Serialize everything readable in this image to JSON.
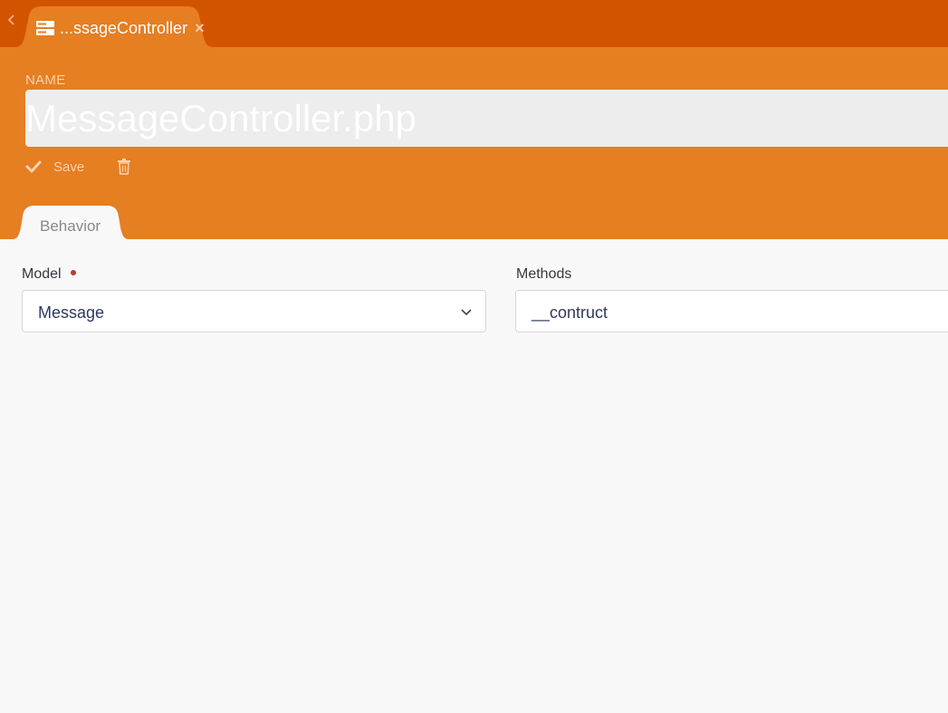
{
  "tabbar": {
    "tab_title": "...ssageController",
    "icons": {
      "back": "chevron-left-icon",
      "file": "server-icon",
      "close": "close-icon"
    }
  },
  "header": {
    "name_label": "NAME",
    "name_value": "MessageController.php",
    "save_label": "Save",
    "icons": {
      "save": "check-icon",
      "delete": "trash-icon"
    }
  },
  "tabs": [
    {
      "label": "Behavior",
      "active": true
    }
  ],
  "form": {
    "model": {
      "label": "Model",
      "required": true,
      "value": "Message"
    },
    "methods": {
      "label": "Methods",
      "value": "__contruct"
    }
  },
  "colors": {
    "tabbar_bg": "#d35400",
    "header_bg": "#e67e22",
    "content_bg": "#f8f8f8",
    "required": "#c0392b"
  }
}
